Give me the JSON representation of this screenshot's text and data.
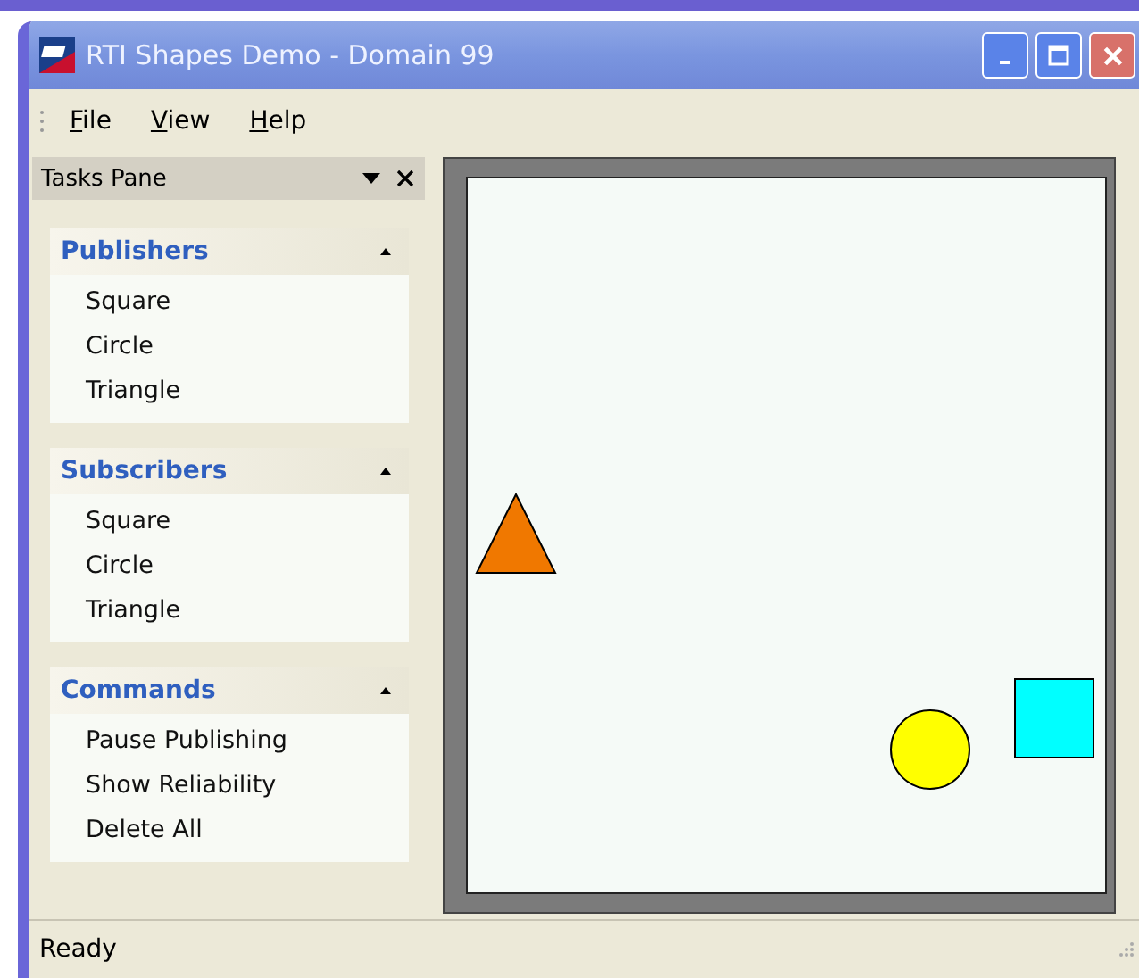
{
  "window": {
    "title": "RTI Shapes Demo - Domain 99"
  },
  "menu": [
    "File",
    "View",
    "Help"
  ],
  "tasks_pane": {
    "title": "Tasks Pane",
    "sections": [
      {
        "title": "Publishers",
        "expanded": true,
        "items": [
          "Square",
          "Circle",
          "Triangle"
        ]
      },
      {
        "title": "Subscribers",
        "expanded": true,
        "items": [
          "Square",
          "Circle",
          "Triangle"
        ]
      },
      {
        "title": "Commands",
        "expanded": true,
        "items": [
          "Pause Publishing",
          "Show Reliability",
          "Delete All"
        ]
      }
    ]
  },
  "canvas": {
    "shapes": [
      {
        "kind": "triangle",
        "color": "#f07800"
      },
      {
        "kind": "circle",
        "color": "#ffff00"
      },
      {
        "kind": "square",
        "color": "#00ffff"
      }
    ]
  },
  "status_bar": "Ready"
}
